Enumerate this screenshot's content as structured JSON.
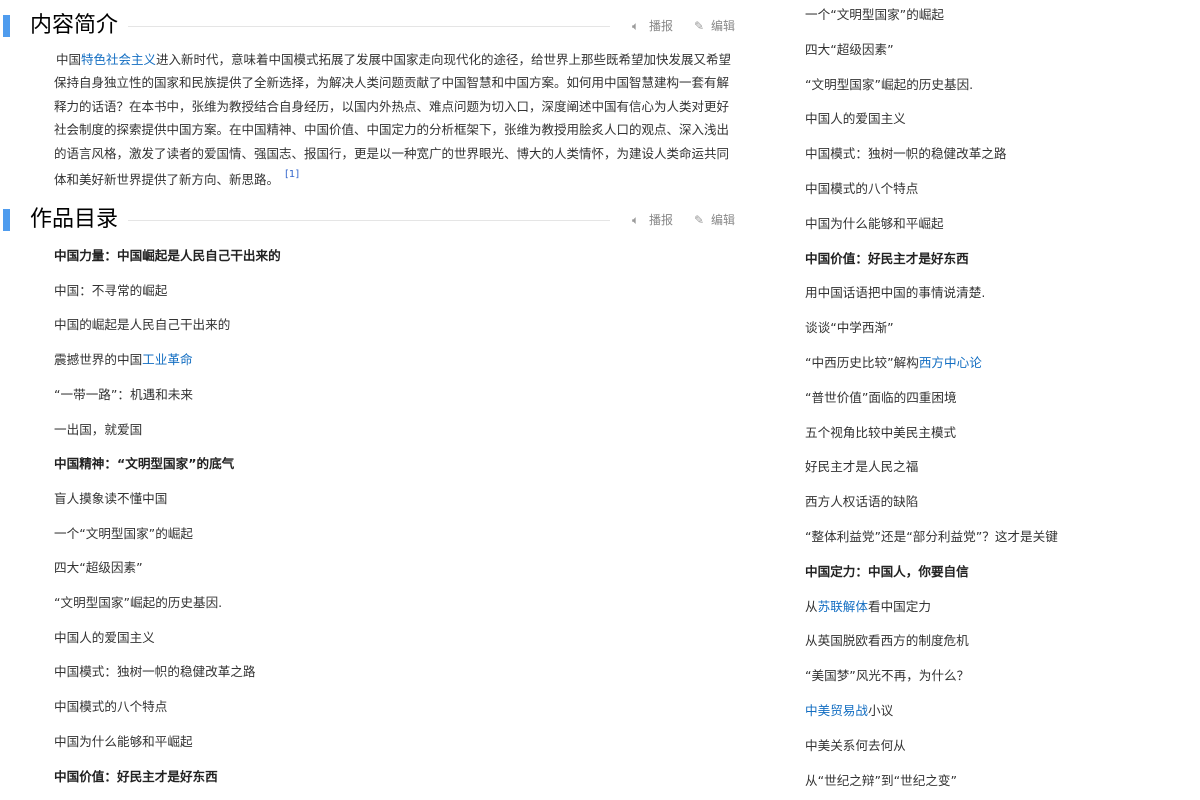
{
  "intro_section": {
    "title": "内容简介",
    "play_label": "播报",
    "edit_label": "编辑",
    "text_before_link": "中国",
    "link_text": "特色社会主义",
    "text_after_link": "进入新时代，意味着中国模式拓展了发展中国家走向现代化的途径，给世界上那些既希望加快发展又希望保持自身独立性的国家和民族提供了全新选择，为解决人类问题贡献了中国智慧和中国方案。如何用中国智慧建构一套有解释力的话语？在本书中，张维为教授结合自身经历，以国内外热点、难点问题为切入口，深度阐述中国有信心为人类对更好社会制度的探索提供中国方案。在中国精神、中国价值、中国定力的分析框架下，张维为教授用脍炙人口的观点、深入浅出的语言风格，激发了读者的爱国情、强国志、报国行，更是以一种宽广的世界眼光、博大的人类情怀，为建设人类命运共同体和美好新世界提供了新方向、新思路。",
    "ref": "[1]"
  },
  "toc_section": {
    "title": "作品目录",
    "play_label": "播报",
    "edit_label": "编辑"
  },
  "toc_left": [
    {
      "text": "中国力量：中国崛起是人民自己干出来的",
      "bold": true
    },
    {
      "text": "中国：不寻常的崛起"
    },
    {
      "text": "中国的崛起是人民自己干出来的"
    },
    {
      "pre": "震撼世界的中国",
      "link": "工业革命",
      "post": ""
    },
    {
      "text": "“一带一路”：机遇和未来"
    },
    {
      "text": "一出国，就爱国"
    },
    {
      "text": "中国精神：“文明型国家”的底气",
      "bold": true
    },
    {
      "text": "盲人摸象读不懂中国"
    },
    {
      "text": "一个“文明型国家”的崛起"
    },
    {
      "text": "四大“超级因素”"
    },
    {
      "text": "“文明型国家”崛起的历史基因."
    },
    {
      "text": "中国人的爱国主义"
    },
    {
      "text": "中国模式：独树一帜的稳健改革之路"
    },
    {
      "text": "中国模式的八个特点"
    },
    {
      "text": "中国为什么能够和平崛起"
    },
    {
      "text": "中国价值：好民主才是好东西",
      "bold": true
    }
  ],
  "toc_right": [
    {
      "text": "一个“文明型国家”的崛起"
    },
    {
      "text": "四大“超级因素”"
    },
    {
      "text": "“文明型国家”崛起的历史基因."
    },
    {
      "text": "中国人的爱国主义"
    },
    {
      "text": "中国模式：独树一帜的稳健改革之路"
    },
    {
      "text": "中国模式的八个特点"
    },
    {
      "text": "中国为什么能够和平崛起"
    },
    {
      "text": "中国价值：好民主才是好东西",
      "bold": true
    },
    {
      "text": "用中国话语把中国的事情说清楚."
    },
    {
      "text": "谈谈“中学西渐”"
    },
    {
      "pre": "“中西历史比较”解构",
      "link": "西方中心论",
      "post": ""
    },
    {
      "text": "“普世价值”面临的四重困境"
    },
    {
      "text": "五个视角比较中美民主模式"
    },
    {
      "text": "好民主才是人民之福"
    },
    {
      "text": "西方人权话语的缺陷"
    },
    {
      "text": "“整体利益党”还是“部分利益党”？这才是关键"
    },
    {
      "text": "中国定力：中国人，你要自信",
      "bold": true
    },
    {
      "pre": "从",
      "link": "苏联解体",
      "post": "看中国定力"
    },
    {
      "text": "从英国脱欧看西方的制度危机"
    },
    {
      "text": "“美国梦”风光不再，为什么？"
    },
    {
      "pre": "",
      "link": "中美贸易战",
      "post": "小议"
    },
    {
      "text": "中美关系何去何从"
    },
    {
      "text": "从“世纪之辩”到“世纪之变”"
    }
  ]
}
